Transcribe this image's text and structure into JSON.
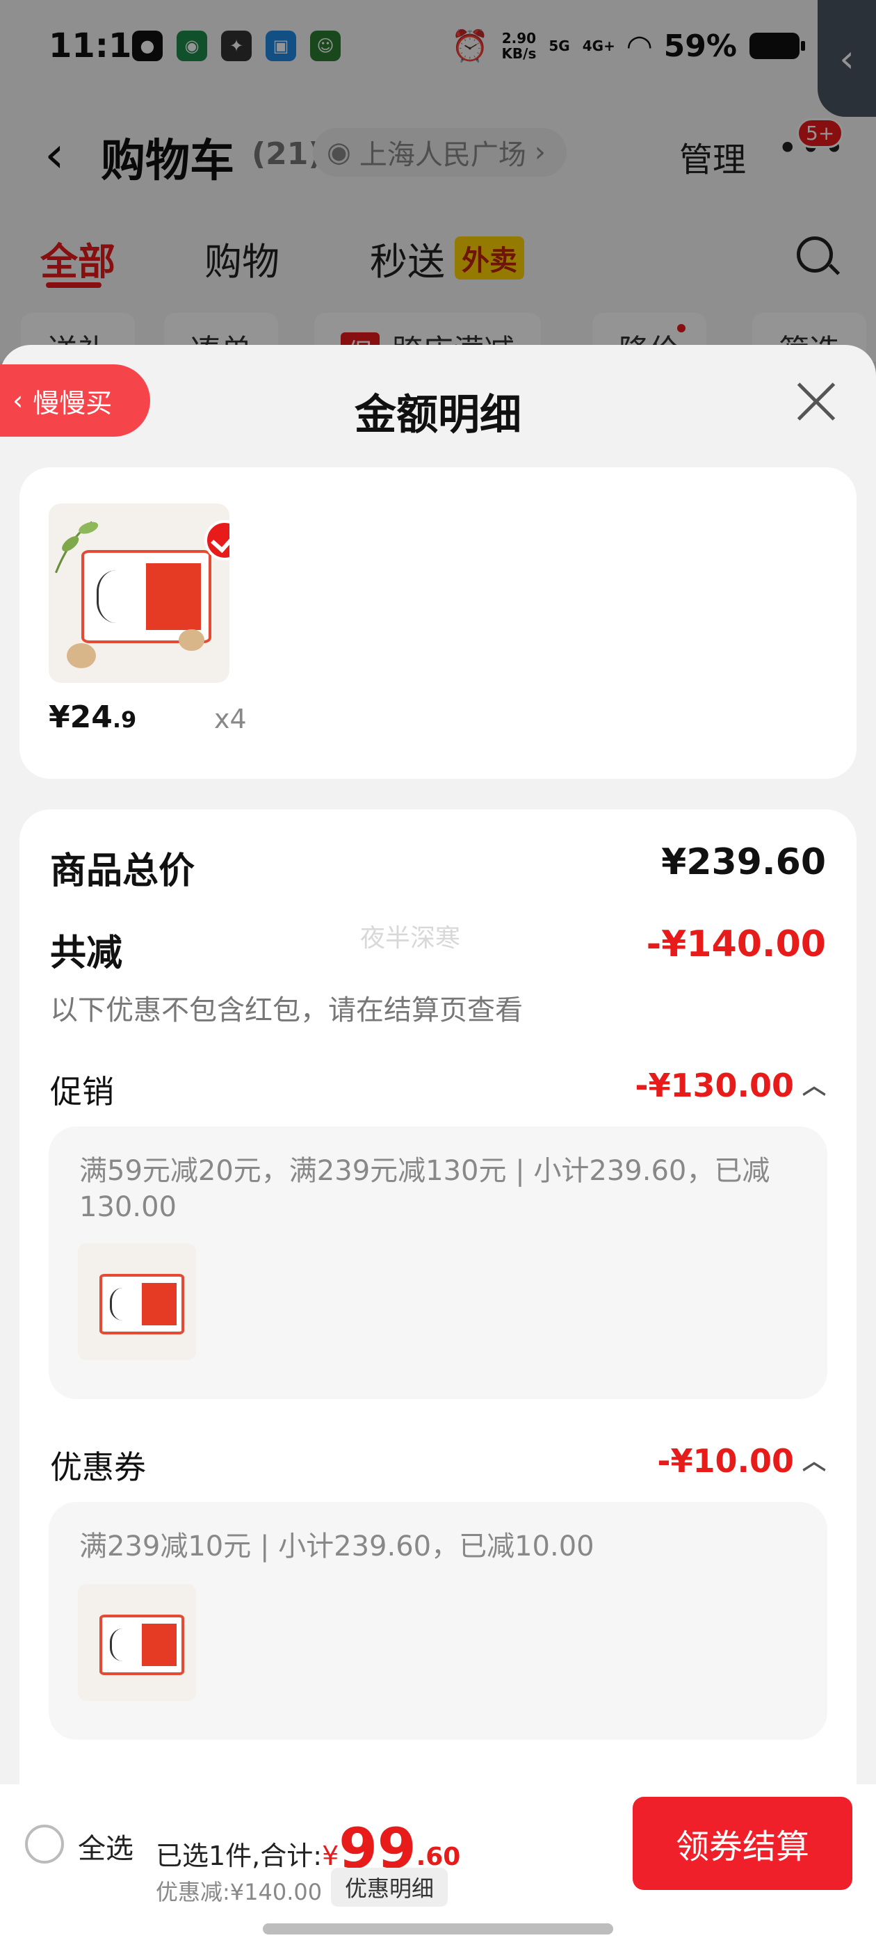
{
  "status_bar": {
    "time": "11:13",
    "net_speed": "2.90",
    "net_unit": "KB/s",
    "sim1": "5G",
    "sim2": "4G+",
    "battery": "59%"
  },
  "nav": {
    "title": "购物车",
    "count": "(21)",
    "location": "上海人民广场",
    "manage": "管理",
    "badge": "5+"
  },
  "tabs": [
    {
      "label": "全部",
      "active": true
    },
    {
      "label": "购物",
      "active": false
    },
    {
      "label": "秒送",
      "active": false,
      "tag": "外卖"
    }
  ],
  "chips": [
    {
      "label": "送礼"
    },
    {
      "label": "凑单"
    },
    {
      "tag": "促",
      "label": "跨店满减"
    },
    {
      "label": "降价"
    },
    {
      "label": "筛选"
    }
  ],
  "sheet": {
    "slow_buy": "慢慢买",
    "title": "金额明细"
  },
  "product": {
    "price_int": "¥24",
    "price_dec": ".9",
    "qty": "x4"
  },
  "detail": {
    "total_label": "商品总价",
    "total_value": "¥239.60",
    "reduce_label": "共减",
    "reduce_value": "-¥140.00",
    "watermark": "夜半深寒",
    "reduce_note": "以下优惠不包含红包，请在结算页查看",
    "promo_label": "促销",
    "promo_value": "-¥130.00",
    "promo_text": "满59元减20元，满239元减130元 | 小计239.60，已减130.00",
    "coupon_label": "优惠券",
    "coupon_value": "-¥10.00",
    "coupon_text": "满239减10元 | 小计239.60，已减10.00"
  },
  "bottom": {
    "select_all": "全选",
    "summary_prefix": "已选1件,合计:",
    "yen": "¥",
    "total_int": "99",
    "total_dec": ".60",
    "discount": "优惠减:¥140.00",
    "detail_button": "优惠明细",
    "checkout_button": "领券结算"
  },
  "colors": {
    "accent_red": "#e81b1b",
    "checkout_red": "#f0202b",
    "slow_buy_red": "#f5454b"
  }
}
